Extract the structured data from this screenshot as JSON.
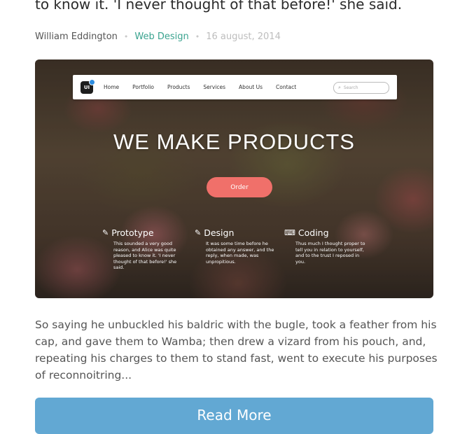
{
  "post": {
    "title": "to know it. 'I never thought of that before!' she said.",
    "author": "William Eddington",
    "category": "Web Design",
    "date": "16 august, 2014",
    "separator": "•",
    "excerpt": "So saying he unbuckled his baldric with the bugle, took a feather from his cap, and gave them to Wamba; then drew a vizard from his pouch, and, repeating his charges to them to stand fast, went to execute his purposes of reconnoitring...",
    "read_more_label": "Read More"
  },
  "hero": {
    "logo_text": "UI",
    "nav_items": [
      "Home",
      "Portfolio",
      "Products",
      "Services",
      "About Us",
      "Contact"
    ],
    "search_placeholder": "Search",
    "headline": "WE MAKE PRODUCTS",
    "order_label": "Order",
    "features": [
      {
        "icon": "pencil-icon",
        "title": "Prototype",
        "text": "This sounded a very good reason, and Alice was quite pleased to know it. 'I never thought of that before!' she said."
      },
      {
        "icon": "pencil-icon",
        "title": "Design",
        "text": "It was some time before he obtained any answer, and the reply, when made, was unpropitious."
      },
      {
        "icon": "keyboard-icon",
        "title": "Coding",
        "text": "Thus much I thought proper to tell you in relation to yourself, and to the trust I reposed in you."
      }
    ]
  },
  "colors": {
    "category": "#3aa38f",
    "read_more_bg": "#62a8d3",
    "order_bg": "#f0706a"
  }
}
